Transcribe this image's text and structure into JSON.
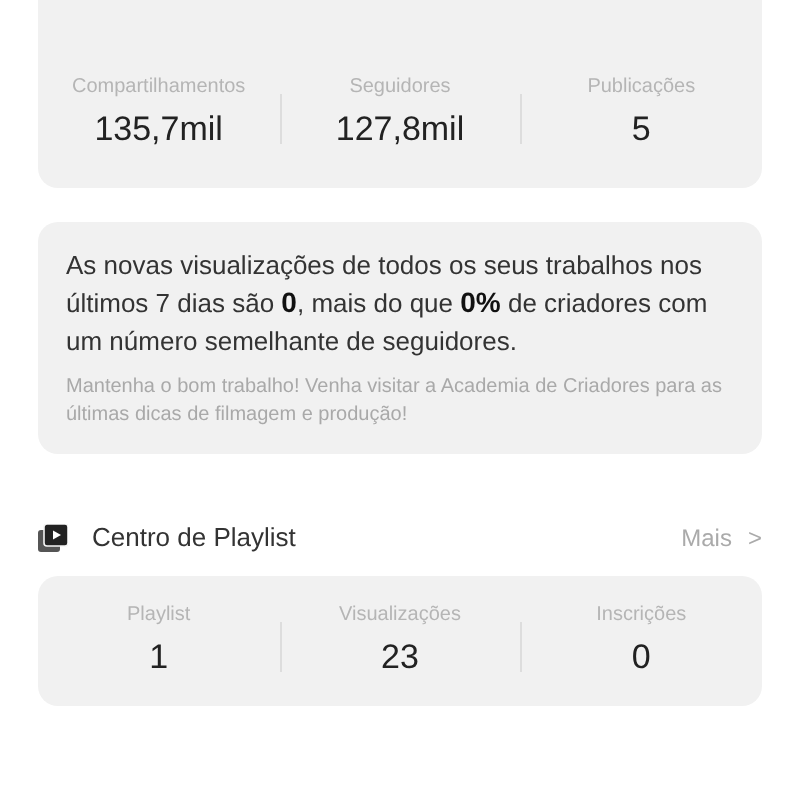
{
  "overview_stats": [
    {
      "label": "Compartilhamentos",
      "value": "135,7mil"
    },
    {
      "label": "Seguidores",
      "value": "127,8mil"
    },
    {
      "label": "Publicações",
      "value": "5"
    }
  ],
  "insight": {
    "message": "As novas visualizações de todos os seus trabalhos nos últimos 7 dias são **0**, mais do que **0%** de criadores com um número semelhante de seguidores.",
    "tip": "Mantenha o bom trabalho! Venha visitar a Academia de Criadores para as últimas dicas de filmagem e produção!"
  },
  "playlist_center": {
    "title": "Centro de Playlist",
    "more": "Mais",
    "chevron": ">",
    "stats": [
      {
        "label": "Playlist",
        "value": "1"
      },
      {
        "label": "Visualizações",
        "value": "23"
      },
      {
        "label": "Inscrições",
        "value": "0"
      }
    ]
  }
}
